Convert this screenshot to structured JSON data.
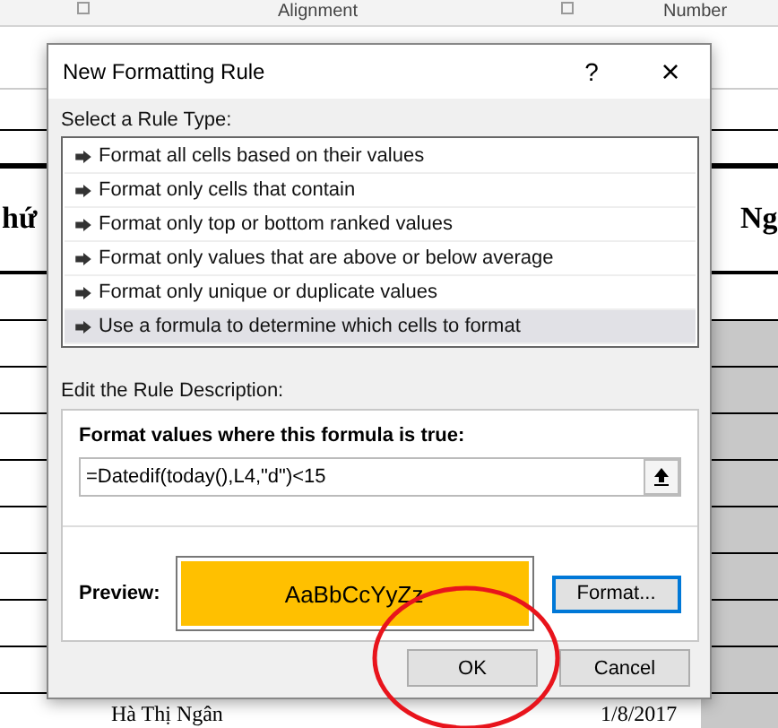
{
  "ribbon": {
    "groups": [
      "Alignment",
      "Number"
    ]
  },
  "sheet": {
    "header_left": "hứ",
    "header_right": "Ng",
    "last_row": [
      "Hà Thị Ngân",
      "1/8/2017"
    ]
  },
  "dialog": {
    "title": "New Formatting Rule",
    "help": "?",
    "close": "×",
    "rule_type_label": "Select a Rule Type:",
    "rule_types": [
      {
        "label": "Format all cells based on their values",
        "selected": false
      },
      {
        "label": "Format only cells that contain",
        "selected": false
      },
      {
        "label": "Format only top or bottom ranked values",
        "selected": false
      },
      {
        "label": "Format only values that are above or below average",
        "selected": false
      },
      {
        "label": "Format only unique or duplicate values",
        "selected": false
      },
      {
        "label": "Use a formula to determine which cells to format",
        "selected": true
      }
    ],
    "description_label": "Edit the Rule Description:",
    "formula_label": "Format values where this formula is true:",
    "formula": "=Datedif(today(),L4,\"d\")<15",
    "preview_label": "Preview:",
    "preview_text": "AaBbCcYyZz",
    "format_button": "Format...",
    "ok": "OK",
    "cancel": "Cancel"
  }
}
